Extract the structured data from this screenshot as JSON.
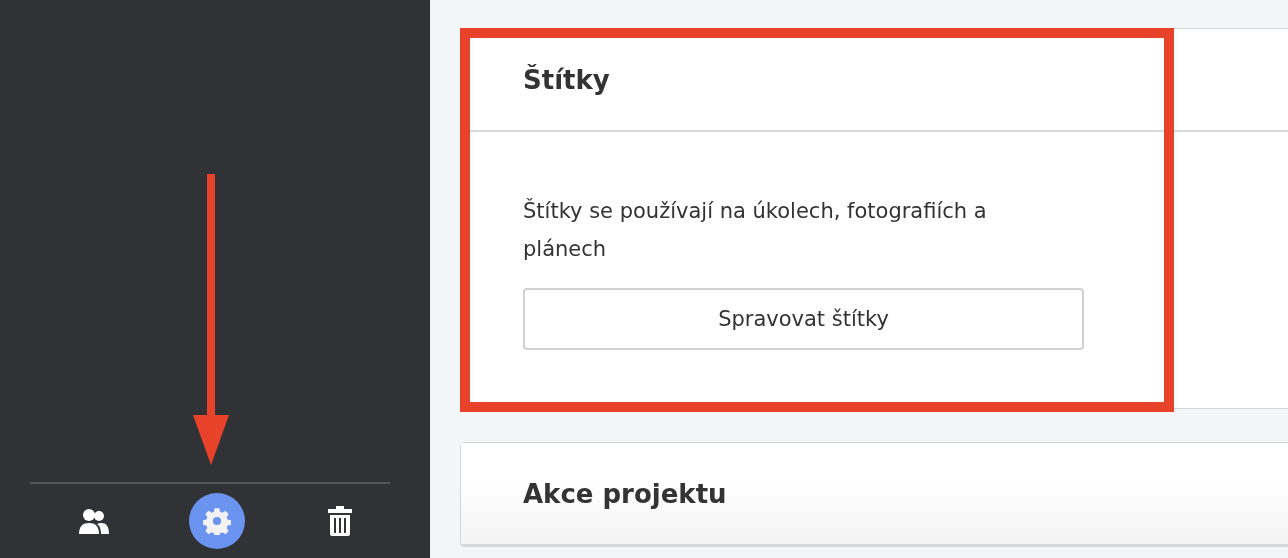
{
  "sidebar": {
    "nav": [
      {
        "kind": "people",
        "selected": false
      },
      {
        "kind": "settings",
        "selected": true
      },
      {
        "kind": "trash",
        "selected": false
      }
    ]
  },
  "cards": [
    {
      "title": "Štítky",
      "highlighted": true,
      "description": "Štítky se používají na úkolech, fotografiích a plánech",
      "button": "Spravovat štítky"
    },
    {
      "title": "Akce projektu",
      "highlighted": false
    }
  ]
}
